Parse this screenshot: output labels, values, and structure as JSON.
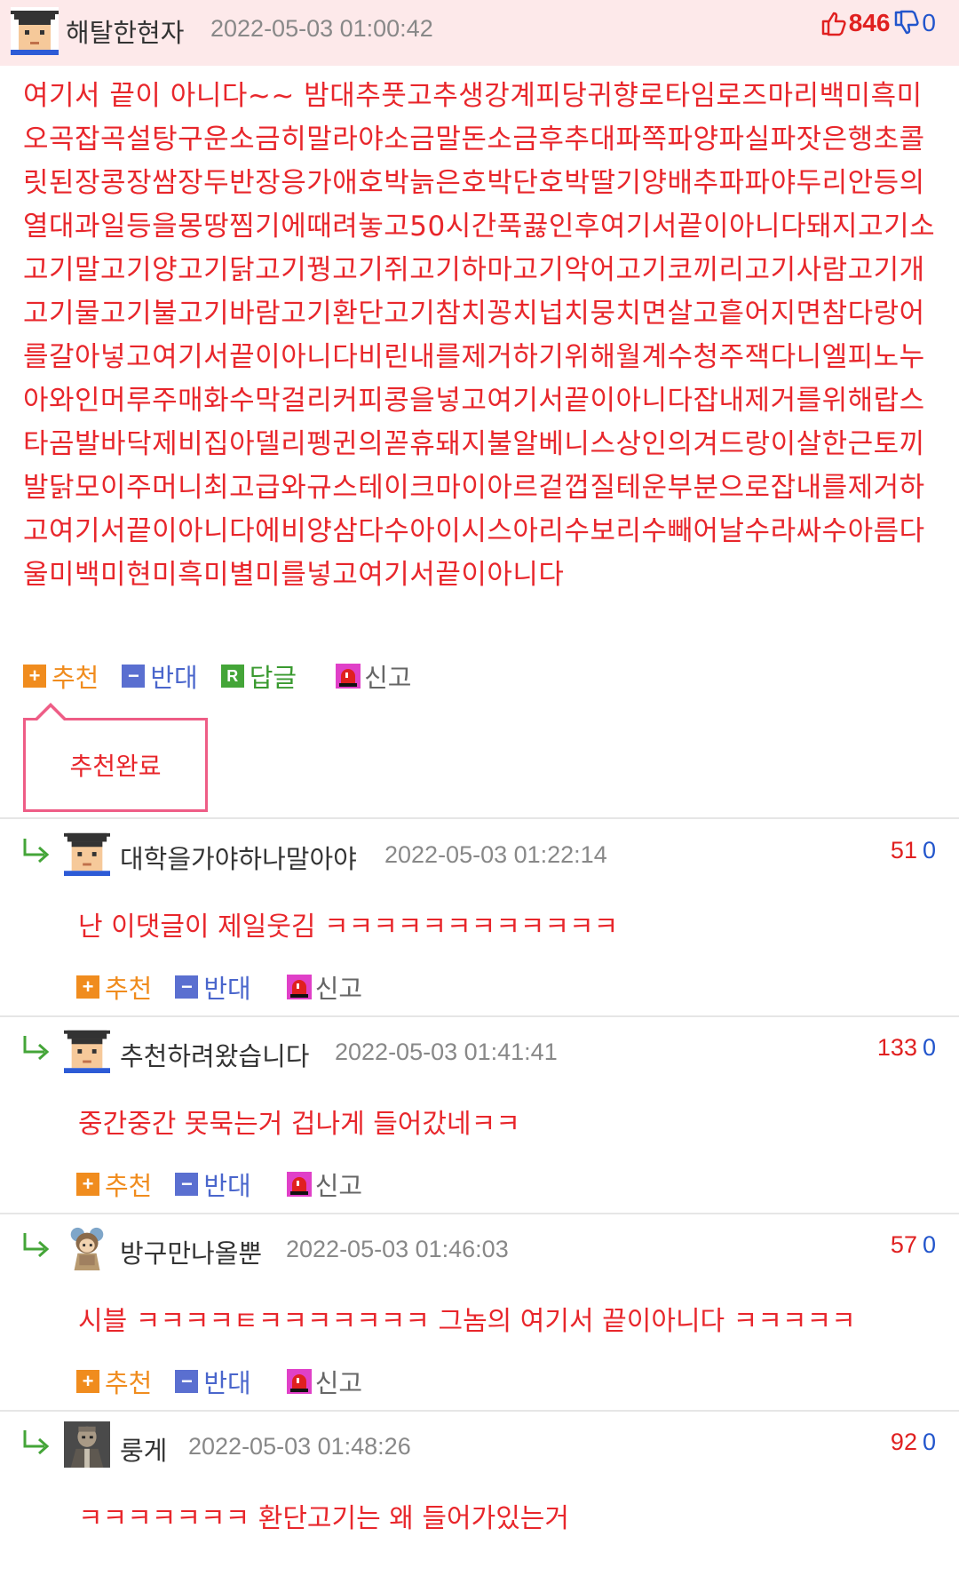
{
  "post": {
    "author": "해탈한현자",
    "date": "2022-05-03 01:00:42",
    "up_count": "846",
    "down_count": "0",
    "body": "여기서 끝이 아니다~~ 밤대추풋고추생강계피당귀향로타임로즈마리백미흑미오곡잡곡설탕구운소금히말라야소금말돈소금후추대파쪽파양파실파잣은행초콜릿된장콩장쌈장두반장응가애호박늙은호박단호박딸기양배추파파야두리안등의열대과일등을몽땅찜기에때려놓고50시간푹끓인후여기서끝이아니다돼지고기소고기말고기양고기닭고기꿩고기쥐고기하마고기악어고기코끼리고기사람고기개고기물고기불고기바람고기환단고기참치꽁치넙치뭉치면살고흩어지면참다랑어를갈아넣고여기서끝이아니다비린내를제거하기위해월계수청주잭다니엘피노누아와인머루주매화수막걸리커피콩을넣고여기서끝이아니다잡내제거를위해랍스타곰발바닥제비집아델리펭귄의꼳휴돼지불알베니스상인의겨드랑이살한근토끼발닭모이주머니최고급와규스테이크마이아르겉껍질테운부분으로잡내를제거하고여기서끝이아니다에비양삼다수아이시스아리수보리수빼어날수라싸수아름다울미백미현미흑미별미를넣고여기서끝이아니다",
    "actions": {
      "recommend": "추천",
      "oppose": "반대",
      "reply": "답글",
      "report": "신고"
    },
    "recommend_done": "추천완료"
  },
  "comments": [
    {
      "author": "대학을가야하나말아야",
      "date": "2022-05-03 01:22:14",
      "up": "51",
      "down": "0",
      "body": "난 이댓글이 제일웃김 ㅋㅋㅋㅋㅋㅋㅋㅋㅋㅋㅋㅋ",
      "actions": {
        "recommend": "추천",
        "oppose": "반대",
        "report": "신고"
      }
    },
    {
      "author": "추천하려왔습니다",
      "date": "2022-05-03 01:41:41",
      "up": "133",
      "down": "0",
      "body": "중간중간 못묵는거 겁나게 들어갔네ㅋㅋ",
      "actions": {
        "recommend": "추천",
        "oppose": "반대",
        "report": "신고"
      }
    },
    {
      "author": "방구만나올뿐",
      "date": "2022-05-03 01:46:03",
      "up": "57",
      "down": "0",
      "body": "시블 ㅋㅋㅋㅋㅌㅋㅋㅋㅋㅋㅋㅋ 그놈의 여기서 끝이아니다 ㅋㅋㅋㅋㅋ",
      "actions": {
        "recommend": "추천",
        "oppose": "반대",
        "report": "신고"
      }
    },
    {
      "author": "룽게",
      "date": "2022-05-03 01:48:26",
      "up": "92",
      "down": "0",
      "body": "ㅋㅋㅋㅋㅋㅋㅋ 환단고기는 왜 들어가있는거"
    }
  ],
  "icons": {
    "up_sign": "+",
    "down_sign": "−",
    "reply_sign": "R"
  }
}
